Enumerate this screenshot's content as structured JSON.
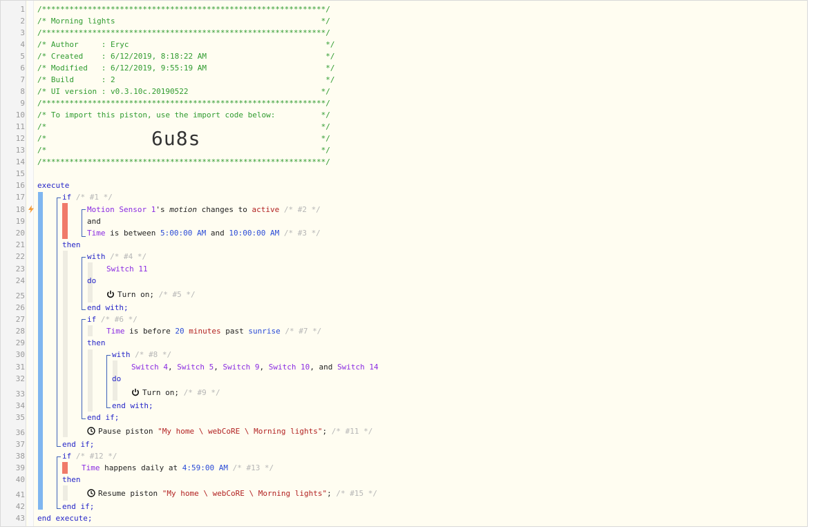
{
  "gutter": {
    "line_numbers": [
      "1",
      "2",
      "3",
      "4",
      "5",
      "6",
      "7",
      "8",
      "9",
      "10",
      "11",
      "12",
      "13",
      "14",
      "15",
      "16",
      "17",
      "18",
      "19",
      "20",
      "21",
      "22",
      "23",
      "24",
      "25",
      "26",
      "27",
      "28",
      "29",
      "30",
      "31",
      "32",
      "33",
      "34",
      "35",
      "36",
      "37",
      "38",
      "39",
      "40",
      "41",
      "42",
      "43"
    ]
  },
  "header": {
    "border": "/**************************************************************/",
    "title": "/* Morning lights                                             */",
    "author": "/* Author     : Eryc                                           */",
    "created": "/* Created    : 6/12/2019, 8:18:22 AM                          */",
    "modified": "/* Modified   : 6/12/2019, 9:55:19 AM                          */",
    "build": "/* Build      : 2                                              */",
    "ui_version": "/* UI version : v0.3.10c.20190522                             */",
    "import_note": "/* To import this piston, use the import code below:          */",
    "blank": "/*                                                            */",
    "import_code": "6u8s"
  },
  "code": {
    "execute": "execute",
    "if": "if",
    "then": "then",
    "and": "and",
    "with": "with",
    "do": "do",
    "end_with": "end with;",
    "end_if": "end if;",
    "end_execute": "end execute;",
    "c1": "/* #1 */",
    "motion_sensor": "Motion Sensor 1",
    "apos_s": "'s ",
    "motion": "motion",
    "changes_to": " changes to ",
    "active": "active",
    "c2": "/* #2 */",
    "time": "Time",
    "is_between": " is between ",
    "t_start": "5:00:00 AM",
    "and_word": " and ",
    "t_end": "10:00:00 AM",
    "c3": "/* #3 */",
    "c4": "/* #4 */",
    "switch11": "Switch 11",
    "turn_on": "Turn on;",
    "c5": "/* #5 */",
    "c6": "/* #6 */",
    "is_before": " is before ",
    "twenty": "20",
    "minutes": "minutes",
    "past": " past ",
    "sunrise": "sunrise",
    "c7": "/* #7 */",
    "c8": "/* #8 */",
    "sw4": "Switch 4",
    "sw5": "Switch 5",
    "sw9": "Switch 9",
    "sw10": "Switch 10",
    "sw14": "Switch 14",
    "comma": ", ",
    "comma_and": ", and ",
    "c9": "/* #9 */",
    "pause_piston": "Pause piston ",
    "piston_path": "\"My home \\ webCoRE \\ Morning lights\"",
    "semicolon": ";",
    "c11": "/* #11 */",
    "c12": "/* #12 */",
    "happens_daily": " happens daily at ",
    "t_daily": "4:59:00 AM",
    "c13": "/* #13 */",
    "resume_piston": "Resume piston ",
    "c15": "/* #15 */"
  },
  "colors": {
    "background": "#fffdf1",
    "comment": "#2f9b2f",
    "keyword": "#2525c8",
    "device": "#8a2be2",
    "string": "#b22222",
    "execute_bar": "#7fb6f0",
    "condition_bar": "#f07a6a"
  }
}
